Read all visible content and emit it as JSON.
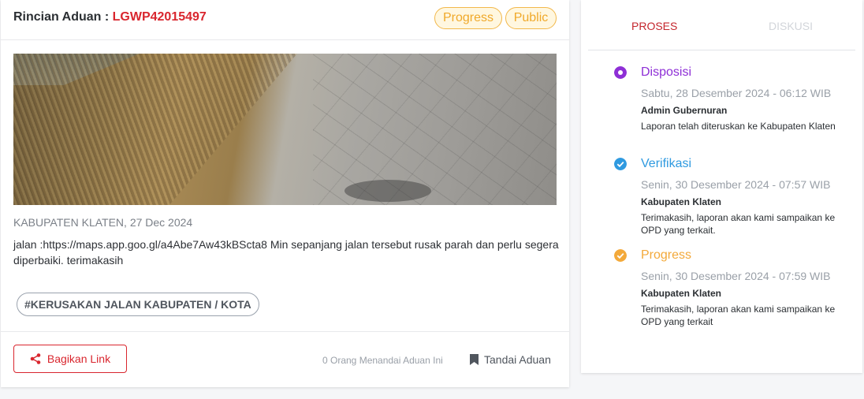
{
  "complaint": {
    "title_label": "Rincian Aduan :",
    "code": "LGWP42015497",
    "badges": [
      "Progress",
      "Public"
    ],
    "meta": "KABUPATEN KLATEN, 27 Dec 2024",
    "description": "jalan :https://maps.app.goo.gl/a4Abe7Aw43kBScta8 Min sepanjang jalan tersebut rusak parah dan perlu segera diperbaiki. terimakasih",
    "tag": "#KERUSAKAN JALAN KABUPATEN / KOTA",
    "share_label": "Bagikan Link",
    "marked_count_text": "0 Orang Menandai Aduan Ini",
    "bookmark_label": "Tandai Aduan"
  },
  "tabs": {
    "proses": "PROSES",
    "diskusi": "DISKUSI"
  },
  "timeline": [
    {
      "status": "Disposisi",
      "date": "Sabtu, 28 Desember 2024 - 06:12 WIB",
      "actor": "Admin Gubernuran",
      "message": "Laporan telah diteruskan ke Kabupaten Klaten",
      "color": "#8e2fd6",
      "icon": "dot-circle-icon"
    },
    {
      "status": "Verifikasi",
      "date": "Senin, 30 Desember 2024 - 07:57 WIB",
      "actor": "Kabupaten Klaten",
      "message": "Terimakasih, laporan akan kami sampaikan ke OPD yang terkait.",
      "color": "#2f9ae0",
      "icon": "check-circle-icon"
    },
    {
      "status": "Progress",
      "date": "Senin, 30 Desember 2024 - 07:59 WIB",
      "actor": "Kabupaten Klaten",
      "message": "Terimakasih, laporan akan kami sampaikan ke OPD yang terkait",
      "color": "#f3a93a",
      "icon": "check-circle-icon"
    }
  ],
  "colors": {
    "accent": "#d9262e",
    "badge": "#f0a92a"
  }
}
